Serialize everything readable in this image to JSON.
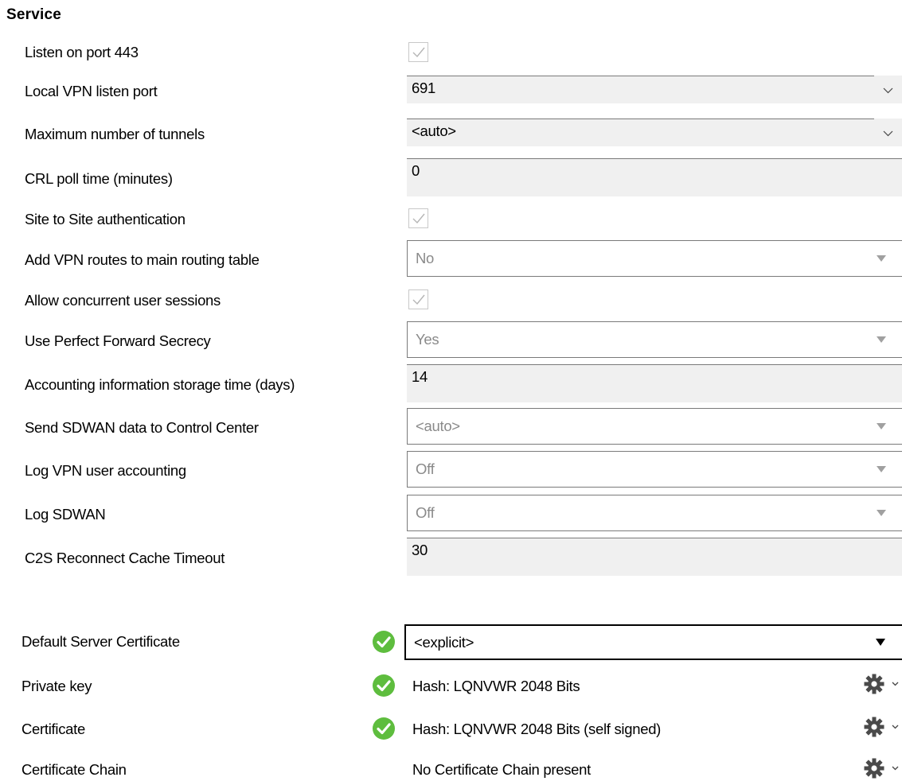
{
  "section_title": "Service",
  "settings": {
    "listen_443": {
      "label": "Listen on port 443",
      "checked": true
    },
    "local_vpn_port": {
      "label": "Local VPN listen port",
      "value": "691"
    },
    "max_tunnels": {
      "label": "Maximum number of tunnels",
      "value": "<auto>"
    },
    "crl_poll": {
      "label": "CRL poll time (minutes)",
      "value": "0"
    },
    "s2s_auth": {
      "label": "Site to Site authentication",
      "checked": true
    },
    "vpn_routes": {
      "label": "Add VPN routes to main routing table",
      "value": "No"
    },
    "concurrent_sessions": {
      "label": "Allow concurrent user sessions",
      "checked": true
    },
    "pfs": {
      "label": "Use Perfect Forward Secrecy",
      "value": "Yes"
    },
    "accounting_time": {
      "label": "Accounting information storage time (days)",
      "value": "14"
    },
    "sdwan_cc": {
      "label": "Send SDWAN data to Control Center",
      "value": "<auto>"
    },
    "log_accounting": {
      "label": "Log VPN user accounting",
      "value": "Off"
    },
    "log_sdwan": {
      "label": "Log SDWAN",
      "value": "Off"
    },
    "c2s_cache": {
      "label": "C2S Reconnect Cache Timeout",
      "value": "30"
    }
  },
  "certificates": {
    "default_server": {
      "label": "Default Server Certificate",
      "value": "<explicit>",
      "status_icon": "check-circle-icon"
    },
    "private_key": {
      "label": "Private key",
      "value": "Hash: LQNVWR 2048 Bits",
      "status_icon": "check-circle-icon"
    },
    "certificate": {
      "label": "Certificate",
      "value": "Hash: LQNVWR 2048 Bits (self signed)",
      "status_icon": "check-circle-icon"
    },
    "chain": {
      "label": "Certificate Chain",
      "value": "No Certificate Chain present"
    }
  },
  "colors": {
    "ok_green": "#5ebd3e",
    "field_gray": "#f0f0f0",
    "border": "#7a7a7a",
    "disabled_text": "#8a8a8a"
  }
}
